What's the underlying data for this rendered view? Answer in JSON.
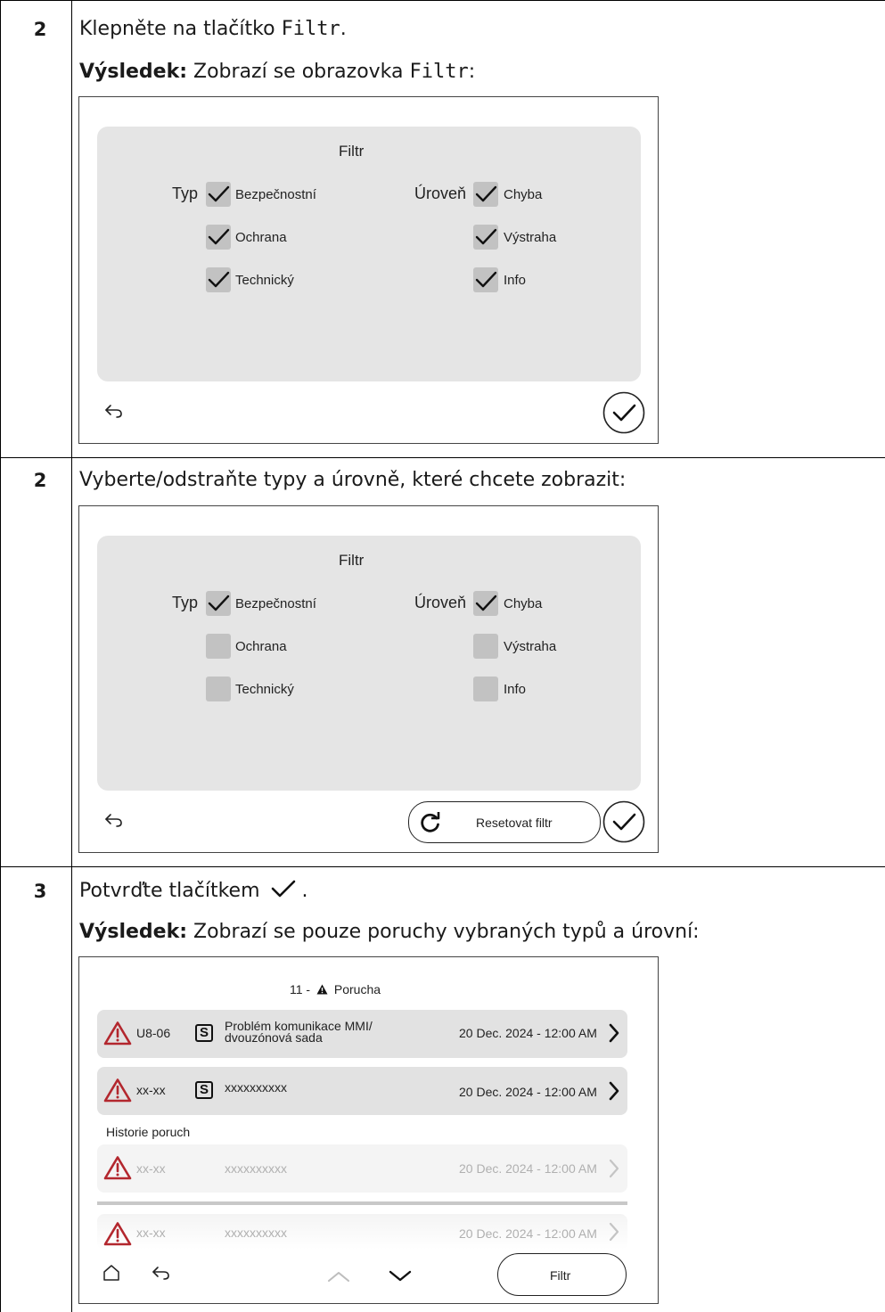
{
  "steps": [
    {
      "number": "2",
      "instruction_prefix": "Klepněte na tlačítko ",
      "instruction_code": "Filtr",
      "instruction_suffix": ".",
      "result_label": "Výsledek:",
      "result_prefix": " Zobrazí se obrazovka ",
      "result_code": "Filtr",
      "result_suffix": ":"
    },
    {
      "number": "2",
      "instruction": "Vyberte/odstraňte typy a úrovně, které chcete zobrazit:"
    },
    {
      "number": "3",
      "instruction_prefix": "Potvrďte tlačítkem ",
      "instruction_suffix": ".",
      "result_label": "Výsledek:",
      "result_text": " Zobrazí se pouze poruchy vybraných typů a úrovní:"
    }
  ],
  "filter_screen": {
    "title": "Filtr",
    "type_label": "Typ",
    "level_label": "Úroveň",
    "type_options": [
      "Bezpečnostní",
      "Ochrana",
      "Technický"
    ],
    "level_options": [
      "Chyba",
      "Výstraha",
      "Info"
    ]
  },
  "screen1": {
    "type_checked": [
      true,
      true,
      true
    ],
    "level_checked": [
      true,
      true,
      true
    ]
  },
  "screen2": {
    "type_checked": [
      true,
      false,
      false
    ],
    "level_checked": [
      true,
      false,
      false
    ],
    "reset_label": "Resetovat filtr"
  },
  "malfunction_screen": {
    "header_count": "11 -",
    "header_label": "Porucha",
    "active": [
      {
        "code": "U8-06",
        "badge": "S",
        "desc_line1": "Problém komunikace MMI/",
        "desc_line2": "dvouzónová sada",
        "datetime": "20 Dec. 2024 - 12:00 AM"
      },
      {
        "code": "xx-xx",
        "badge": "S",
        "desc_line1": "xxxxxxxxxx",
        "desc_line2": "",
        "datetime": "20 Dec. 2024 - 12:00 AM"
      }
    ],
    "history_label": "Historie poruch",
    "history": [
      {
        "code": "xx-xx",
        "desc": "xxxxxxxxxx",
        "datetime": "20 Dec. 2024 - 12:00 AM"
      },
      {
        "code": "xx-xx",
        "desc": "xxxxxxxxxx",
        "datetime": "20 Dec. 2024 - 12:00 AM"
      }
    ],
    "filter_button": "Filtr"
  },
  "colors": {
    "warning": "#b3272e",
    "panel": "#e5e5e5",
    "checkbox": "#c2c2c2"
  }
}
